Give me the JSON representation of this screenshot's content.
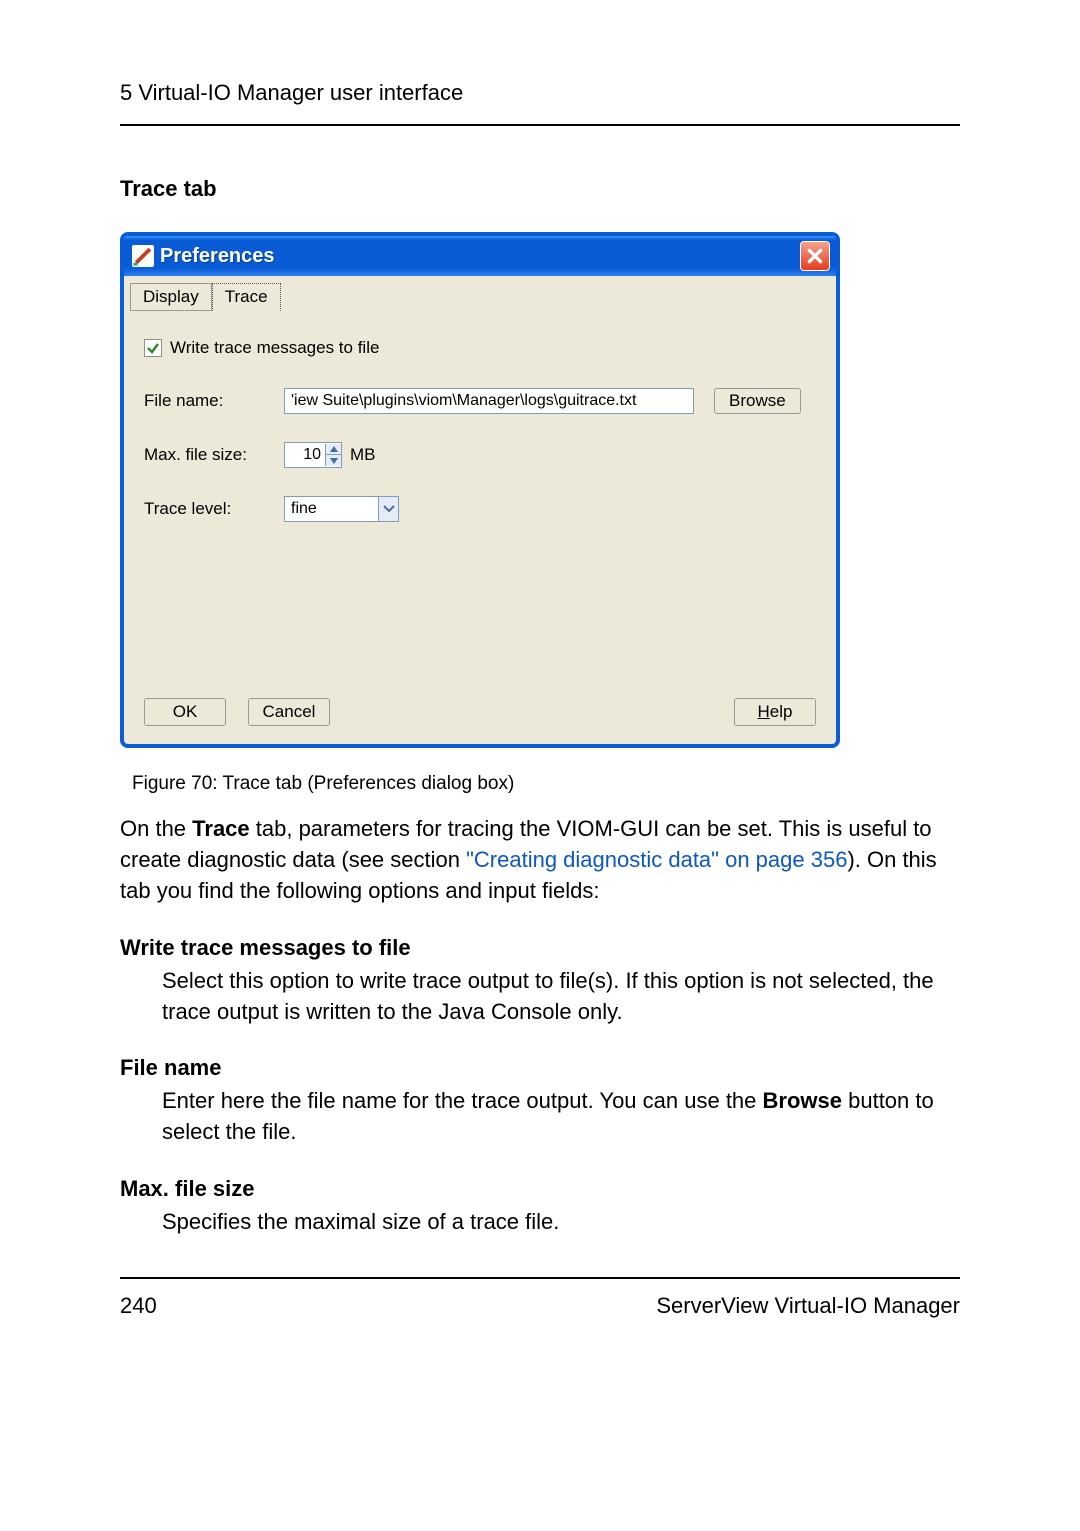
{
  "header": {
    "chapter": "5 Virtual-IO Manager user interface"
  },
  "section": {
    "title": "Trace tab"
  },
  "dialog": {
    "title": "Preferences",
    "tabs": {
      "display": "Display",
      "trace": "Trace"
    },
    "checkbox_label": "Write trace messages to file",
    "file_name_label": "File name:",
    "file_name_value": "'iew Suite\\plugins\\viom\\Manager\\logs\\guitrace.txt",
    "browse": "Browse",
    "max_size_label": "Max. file size:",
    "max_size_value": "10",
    "max_size_unit": "MB",
    "trace_level_label": "Trace level:",
    "trace_level_value": "fine",
    "ok": "OK",
    "cancel": "Cancel",
    "help": "Help"
  },
  "figure_caption": "Figure 70: Trace tab (Preferences dialog box)",
  "para1_a": "On the ",
  "para1_b": "Trace",
  "para1_c": " tab, parameters for tracing the VIOM-GUI can be set. This is useful to create diagnostic data (see section ",
  "para1_link": "\"Creating diagnostic data\" on page 356",
  "para1_d": "). On this tab you find the following options and input fields:",
  "def1_term": "Write trace messages to file",
  "def1_body": "Select this option to write trace output to file(s). If this option is not selected, the trace output is written to the Java Console only.",
  "def2_term": "File name",
  "def2_body_a": "Enter here the file name for the trace output. You can use the ",
  "def2_body_b": "Browse",
  "def2_body_c": " button to select the file.",
  "def3_term": "Max. file size",
  "def3_body": "Specifies the maximal size of a trace file.",
  "footer": {
    "page": "240",
    "product": "ServerView Virtual-IO Manager"
  }
}
